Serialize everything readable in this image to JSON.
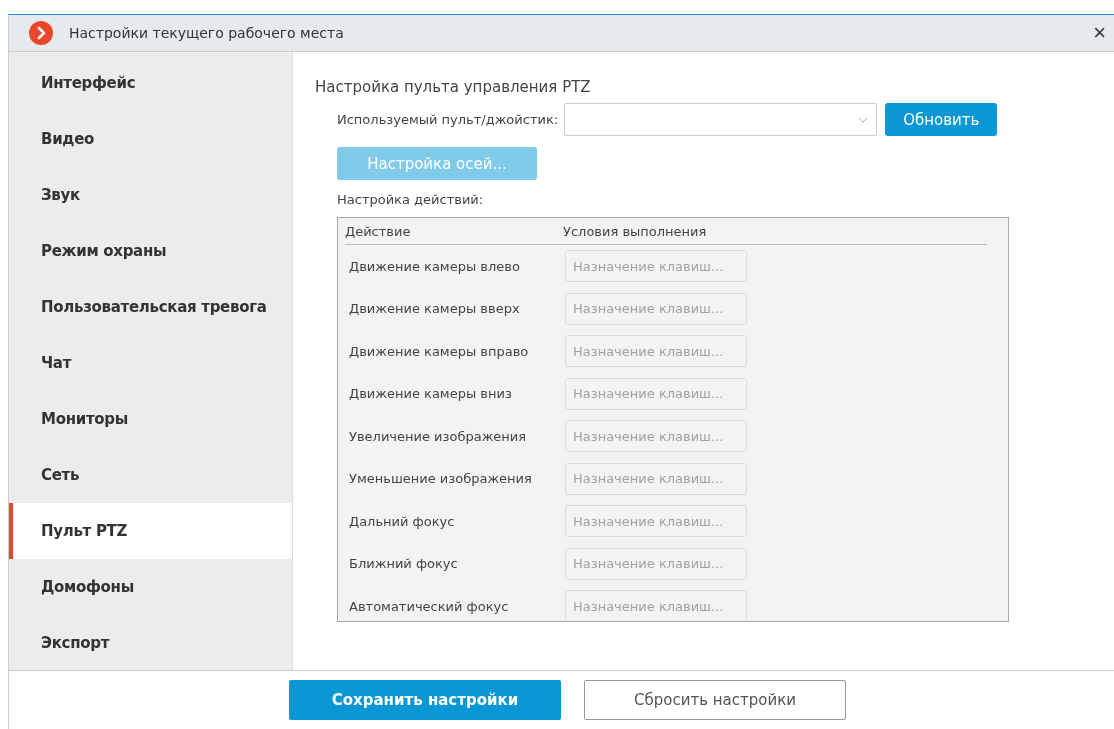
{
  "window": {
    "title": "Настройки текущего рабочего места",
    "close": "×"
  },
  "sidebar": {
    "items": [
      {
        "label": "Интерфейс",
        "selected": false
      },
      {
        "label": "Видео",
        "selected": false
      },
      {
        "label": "Звук",
        "selected": false
      },
      {
        "label": "Режим охраны",
        "selected": false
      },
      {
        "label": "Пользовательская тревога",
        "selected": false
      },
      {
        "label": "Чат",
        "selected": false
      },
      {
        "label": "Мониторы",
        "selected": false
      },
      {
        "label": "Сеть",
        "selected": false
      },
      {
        "label": "Пульт PTZ",
        "selected": true
      },
      {
        "label": "Домофоны",
        "selected": false
      },
      {
        "label": "Экспорт",
        "selected": false
      }
    ]
  },
  "panel": {
    "heading": "Настройка пульта управления PTZ",
    "device_label": "Используемый пульт/джойстик:",
    "refresh_button": {
      "label": "Обновить",
      "disabled": false
    },
    "axes_button": {
      "label": "Настройка осей...",
      "disabled": true
    },
    "actions_label": "Настройка действий:",
    "table": {
      "columns": [
        "Действие",
        "Условия выполнения"
      ],
      "rows": [
        {
          "action": "Движение камеры влево",
          "condition": "Назначение клавиш...",
          "disabled": true
        },
        {
          "action": "Движение камеры вверх",
          "condition": "Назначение клавиш...",
          "disabled": true
        },
        {
          "action": "Движение камеры вправо",
          "condition": "Назначение клавиш...",
          "disabled": true
        },
        {
          "action": "Движение камеры вниз",
          "condition": "Назначение клавиш...",
          "disabled": true
        },
        {
          "action": "Увеличение изображения",
          "condition": "Назначение клавиш...",
          "disabled": true
        },
        {
          "action": "Уменьшение изображения",
          "condition": "Назначение клавиш...",
          "disabled": true
        },
        {
          "action": "Дальний фокус",
          "condition": "Назначение клавиш...",
          "disabled": true
        },
        {
          "action": "Ближний фокус",
          "condition": "Назначение клавиш...",
          "disabled": true
        },
        {
          "action": "Автоматический фокус",
          "condition": "Назначение клавиш...",
          "disabled": true
        }
      ]
    }
  },
  "footer": {
    "buttons": [
      {
        "label": "Сохранить настройки",
        "kind": "primary"
      },
      {
        "label": "Сбросить настройки",
        "kind": "secondary"
      }
    ]
  }
}
